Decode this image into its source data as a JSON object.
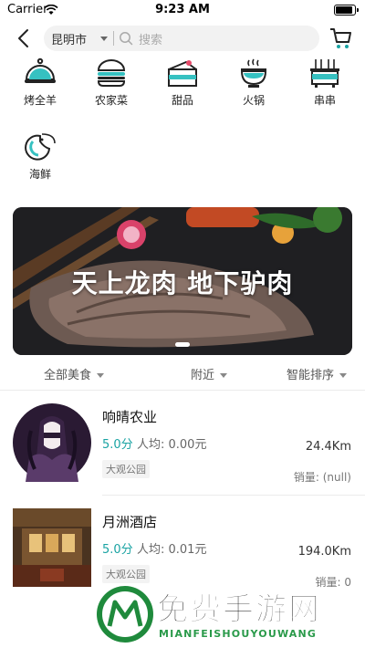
{
  "status_bar": {
    "carrier": "Carrier",
    "time": "9:23 AM",
    "battery_level": 0.95
  },
  "nav": {
    "city": "昆明市",
    "search_placeholder": "搜索"
  },
  "categories": [
    {
      "label": "烤全羊",
      "icon": "cloche-icon"
    },
    {
      "label": "农家菜",
      "icon": "burger-icon"
    },
    {
      "label": "甜品",
      "icon": "cake-icon"
    },
    {
      "label": "火锅",
      "icon": "hotpot-icon"
    },
    {
      "label": "串串",
      "icon": "skewer-pot-icon"
    },
    {
      "label": "海鲜",
      "icon": "shrimp-icon"
    }
  ],
  "banner": {
    "title": "天上龙肉 地下驴肉"
  },
  "filters": [
    {
      "label": "全部美食"
    },
    {
      "label": "附近"
    },
    {
      "label": "智能排序"
    }
  ],
  "stores": [
    {
      "name": "响晴农业",
      "rating": "5.0分",
      "avg_price": "人均: 0.00元",
      "district": "大观公园",
      "distance": "24.4Km",
      "sales": "销量: (null)"
    },
    {
      "name": "月洲酒店",
      "rating": "5.0分",
      "avg_price": "人均: 0.01元",
      "district": "大观公园",
      "distance": "194.0Km",
      "sales": "销量: 0"
    }
  ],
  "watermark": {
    "title": "免费手游网",
    "subtitle": "MIANFEISHOUYOUWANG"
  },
  "colors": {
    "accent": "#1aa3a3",
    "watermark_green": "#2a9a4a"
  }
}
